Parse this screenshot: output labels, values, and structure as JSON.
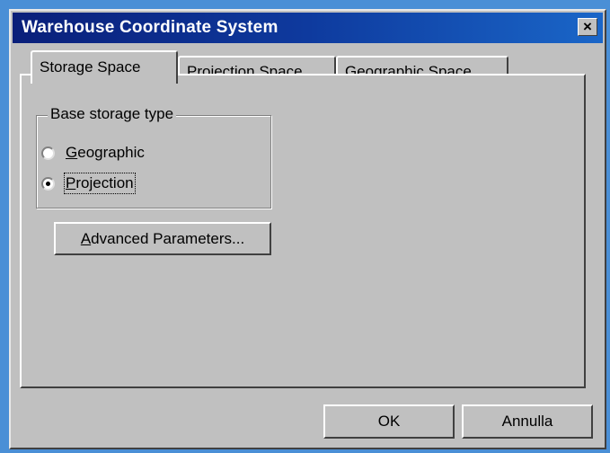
{
  "window": {
    "title": "Warehouse Coordinate System",
    "close_label": "×"
  },
  "tabs": [
    {
      "label": "Storage Space",
      "active": true
    },
    {
      "label": "Projection Space",
      "active": false
    },
    {
      "label": "Geographic Space",
      "active": false
    }
  ],
  "storage": {
    "group_label": "Base storage type",
    "options": [
      {
        "label_accel": "G",
        "label_rest": "eographic",
        "checked": false
      },
      {
        "label_accel": "P",
        "label_rest": "rojection",
        "checked": true
      }
    ],
    "advanced_accel": "A",
    "advanced_rest": "dvanced Parameters..."
  },
  "footer": {
    "ok_label": "OK",
    "cancel_label": "Annulla"
  },
  "colors": {
    "titlebar_start": "#0a1f7a",
    "titlebar_end": "#1a66c8",
    "face": "#c0c0c0",
    "background": "#4a8fd6"
  }
}
